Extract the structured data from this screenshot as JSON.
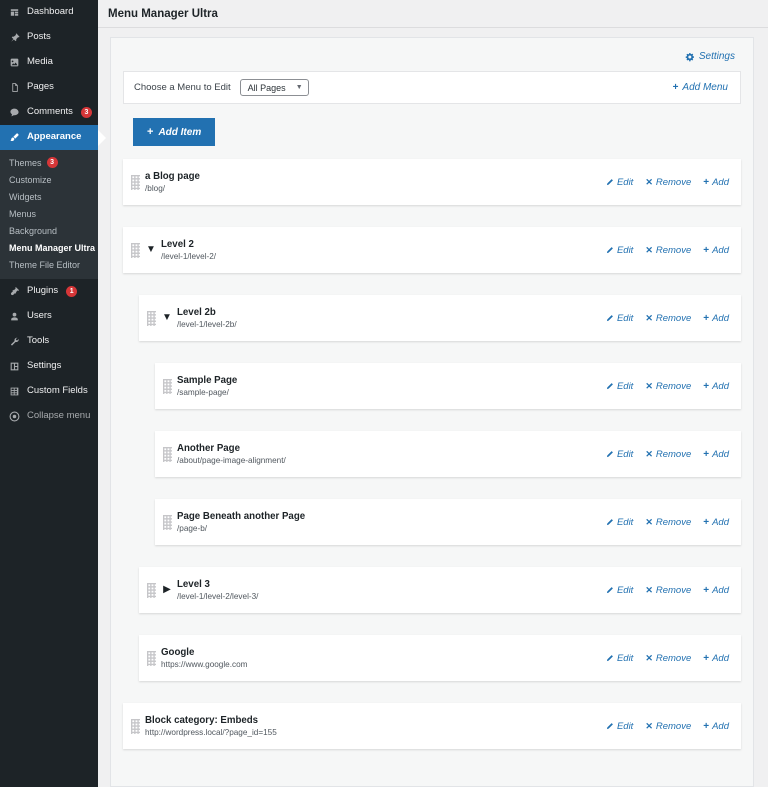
{
  "sidebar": {
    "items": [
      {
        "label": "Dashboard",
        "icon": "dashboard-icon",
        "badge": null,
        "current": false
      },
      {
        "label": "Posts",
        "icon": "pin-icon",
        "badge": null,
        "current": false
      },
      {
        "label": "Media",
        "icon": "media-icon",
        "badge": null,
        "current": false
      },
      {
        "label": "Pages",
        "icon": "pages-icon",
        "badge": null,
        "current": false
      },
      {
        "label": "Comments",
        "icon": "comment-icon",
        "badge": "3",
        "current": false
      },
      {
        "label": "Appearance",
        "icon": "brush-icon",
        "badge": null,
        "current": true
      }
    ],
    "submenu": [
      {
        "label": "Themes",
        "badge": "3",
        "current": false
      },
      {
        "label": "Customize",
        "badge": null,
        "current": false
      },
      {
        "label": "Widgets",
        "badge": null,
        "current": false
      },
      {
        "label": "Menus",
        "badge": null,
        "current": false
      },
      {
        "label": "Background",
        "badge": null,
        "current": false
      },
      {
        "label": "Menu Manager Ultra",
        "badge": null,
        "current": true
      },
      {
        "label": "Theme File Editor",
        "badge": null,
        "current": false
      }
    ],
    "items_after": [
      {
        "label": "Plugins",
        "icon": "plug-icon",
        "badge": "1",
        "current": false
      },
      {
        "label": "Users",
        "icon": "users-icon",
        "badge": null,
        "current": false
      },
      {
        "label": "Tools",
        "icon": "tools-icon",
        "badge": null,
        "current": false
      },
      {
        "label": "Settings",
        "icon": "settings-icon",
        "badge": null,
        "current": false
      },
      {
        "label": "Custom Fields",
        "icon": "table-icon",
        "badge": null,
        "current": false
      }
    ],
    "collapse": {
      "label": "Collapse menu",
      "icon": "collapse-icon"
    }
  },
  "header": {
    "title": "Menu Manager Ultra"
  },
  "toolbar": {
    "settings_label": "Settings",
    "settings_icon": "gear-icon",
    "add_menu_label": "Add Menu",
    "add_menu_icon": "plus-icon",
    "choose_menu_label": "Choose a Menu to Edit",
    "selected_menu": "All Pages",
    "menu_options": [
      "All Pages"
    ],
    "add_item_label": "Add Item",
    "add_item_icon": "plus-icon"
  },
  "actions": {
    "edit_label": "Edit",
    "edit_icon": "pencil-icon",
    "remove_label": "Remove",
    "remove_icon": "close-icon",
    "add_label": "Add",
    "add_icon": "plus-icon"
  },
  "colors": {
    "accent": "#2271b1",
    "sidebar_bg": "#1d2327",
    "submenu_bg": "#2c3338",
    "badge": "#d63638",
    "page_bg": "#f0f0f1",
    "row_bg": "#ffffff"
  },
  "menu_items": [
    {
      "title": "a Blog page",
      "url": "/blog/",
      "depth": 0,
      "toggle": "none"
    },
    {
      "title": "Level 2",
      "url": "/level-1/level-2/",
      "depth": 0,
      "toggle": "expanded"
    },
    {
      "title": "Level 2b",
      "url": "/level-1/level-2b/",
      "depth": 1,
      "toggle": "expanded"
    },
    {
      "title": "Sample Page",
      "url": "/sample-page/",
      "depth": 2,
      "toggle": "none"
    },
    {
      "title": "Another Page",
      "url": "/about/page-image-alignment/",
      "depth": 2,
      "toggle": "none"
    },
    {
      "title": "Page Beneath another Page",
      "url": "/page-b/",
      "depth": 2,
      "toggle": "none"
    },
    {
      "title": "Level 3",
      "url": "/level-1/level-2/level-3/",
      "depth": 1,
      "toggle": "collapsed"
    },
    {
      "title": "Google",
      "url": "https://www.google.com",
      "depth": 1,
      "toggle": "none"
    },
    {
      "title": "Block category: Embeds",
      "url": "http://wordpress.local/?page_id=155",
      "depth": 0,
      "toggle": "none"
    }
  ]
}
